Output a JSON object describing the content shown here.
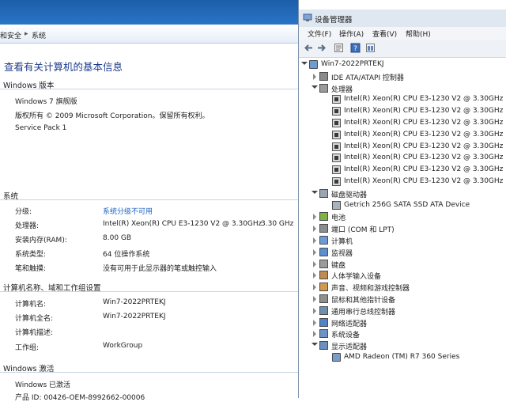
{
  "system": {
    "breadcrumb": [
      "和安全",
      "系统"
    ],
    "page_title": "查看有关计算机的基本信息",
    "edition_header": "Windows 版本",
    "edition": [
      "Windows 7 旗舰版",
      "版权所有 © 2009 Microsoft Corporation。保留所有权利。",
      "Service Pack 1"
    ],
    "system_header": "系统",
    "system_rows": [
      {
        "label": "分级:",
        "value": "系统分级不可用",
        "link": true
      },
      {
        "label": "处理器:",
        "value": "Intel(R) Xeon(R) CPU E3-1230 V2 @ 3.30GHz",
        "value2": "3.30 GHz"
      },
      {
        "label": "安装内存(RAM):",
        "value": "8.00 GB"
      },
      {
        "label": "系统类型:",
        "value": "64 位操作系统"
      },
      {
        "label": "笔和触摸:",
        "value": "没有可用于此显示器的笔或触控输入"
      }
    ],
    "computer_header": "计算机名称、域和工作组设置",
    "computer_rows": [
      {
        "label": "计算机名:",
        "value": "Win7-2022PRTEKJ"
      },
      {
        "label": "计算机全名:",
        "value": "Win7-2022PRTEKJ"
      },
      {
        "label": "计算机描述:",
        "value": ""
      },
      {
        "label": "工作组:",
        "value": "WorkGroup"
      }
    ],
    "activation_header": "Windows 激活",
    "activation_status": "Windows 已激活",
    "product_id": "产品 ID: 00426-OEM-8992662-00006"
  },
  "device_manager": {
    "title": "设备管理器",
    "menu": [
      "文件(F)",
      "操作(A)",
      "查看(V)",
      "帮助(H)"
    ],
    "toolbar_icons": [
      "back-icon",
      "forward-icon",
      "properties-icon",
      "help-icon",
      "show-hidden-icon"
    ],
    "tree": [
      {
        "level": 0,
        "expander": "open",
        "icon": "computer-icon",
        "label": "Win7-2022PRTEKJ"
      },
      {
        "level": 1,
        "expander": "closed",
        "icon": "ide-icon",
        "label": "IDE ATA/ATAPI 控制器"
      },
      {
        "level": 1,
        "expander": "open",
        "icon": "processor-icon",
        "label": "处理器"
      },
      {
        "level": 2,
        "expander": "none",
        "icon": "cpu-icon",
        "label": "Intel(R) Xeon(R) CPU E3-1230 V2 @ 3.30GHz"
      },
      {
        "level": 2,
        "expander": "none",
        "icon": "cpu-icon",
        "label": "Intel(R) Xeon(R) CPU E3-1230 V2 @ 3.30GHz"
      },
      {
        "level": 2,
        "expander": "none",
        "icon": "cpu-icon",
        "label": "Intel(R) Xeon(R) CPU E3-1230 V2 @ 3.30GHz"
      },
      {
        "level": 2,
        "expander": "none",
        "icon": "cpu-icon",
        "label": "Intel(R) Xeon(R) CPU E3-1230 V2 @ 3.30GHz"
      },
      {
        "level": 2,
        "expander": "none",
        "icon": "cpu-icon",
        "label": "Intel(R) Xeon(R) CPU E3-1230 V2 @ 3.30GHz"
      },
      {
        "level": 2,
        "expander": "none",
        "icon": "cpu-icon",
        "label": "Intel(R) Xeon(R) CPU E3-1230 V2 @ 3.30GHz"
      },
      {
        "level": 2,
        "expander": "none",
        "icon": "cpu-icon",
        "label": "Intel(R) Xeon(R) CPU E3-1230 V2 @ 3.30GHz"
      },
      {
        "level": 2,
        "expander": "none",
        "icon": "cpu-icon",
        "label": "Intel(R) Xeon(R) CPU E3-1230 V2 @ 3.30GHz"
      },
      {
        "level": 1,
        "expander": "open",
        "icon": "disk-drive-icon",
        "label": "磁盘驱动器"
      },
      {
        "level": 2,
        "expander": "none",
        "icon": "disk-icon",
        "label": "Getrich 256G SATA SSD ATA Device"
      },
      {
        "level": 1,
        "expander": "closed",
        "icon": "battery-icon",
        "label": "电池"
      },
      {
        "level": 1,
        "expander": "closed",
        "icon": "port-icon",
        "label": "端口 (COM 和 LPT)"
      },
      {
        "level": 1,
        "expander": "closed",
        "icon": "computer-icon",
        "label": "计算机"
      },
      {
        "level": 1,
        "expander": "closed",
        "icon": "monitor-icon",
        "label": "监视器"
      },
      {
        "level": 1,
        "expander": "closed",
        "icon": "keyboard-icon",
        "label": "键盘"
      },
      {
        "level": 1,
        "expander": "closed",
        "icon": "hid-icon",
        "label": "人体学输入设备"
      },
      {
        "level": 1,
        "expander": "closed",
        "icon": "sound-icon",
        "label": "声音、视频和游戏控制器"
      },
      {
        "level": 1,
        "expander": "closed",
        "icon": "mouse-icon",
        "label": "鼠标和其他指针设备"
      },
      {
        "level": 1,
        "expander": "closed",
        "icon": "usb-icon",
        "label": "通用串行总线控制器"
      },
      {
        "level": 1,
        "expander": "closed",
        "icon": "network-icon",
        "label": "网络适配器"
      },
      {
        "level": 1,
        "expander": "closed",
        "icon": "system-device-icon",
        "label": "系统设备"
      },
      {
        "level": 1,
        "expander": "open",
        "icon": "display-adapter-icon",
        "label": "显示适配器"
      },
      {
        "level": 2,
        "expander": "none",
        "icon": "display-icon",
        "label": "AMD Radeon (TM) R7 360 Series"
      }
    ]
  }
}
